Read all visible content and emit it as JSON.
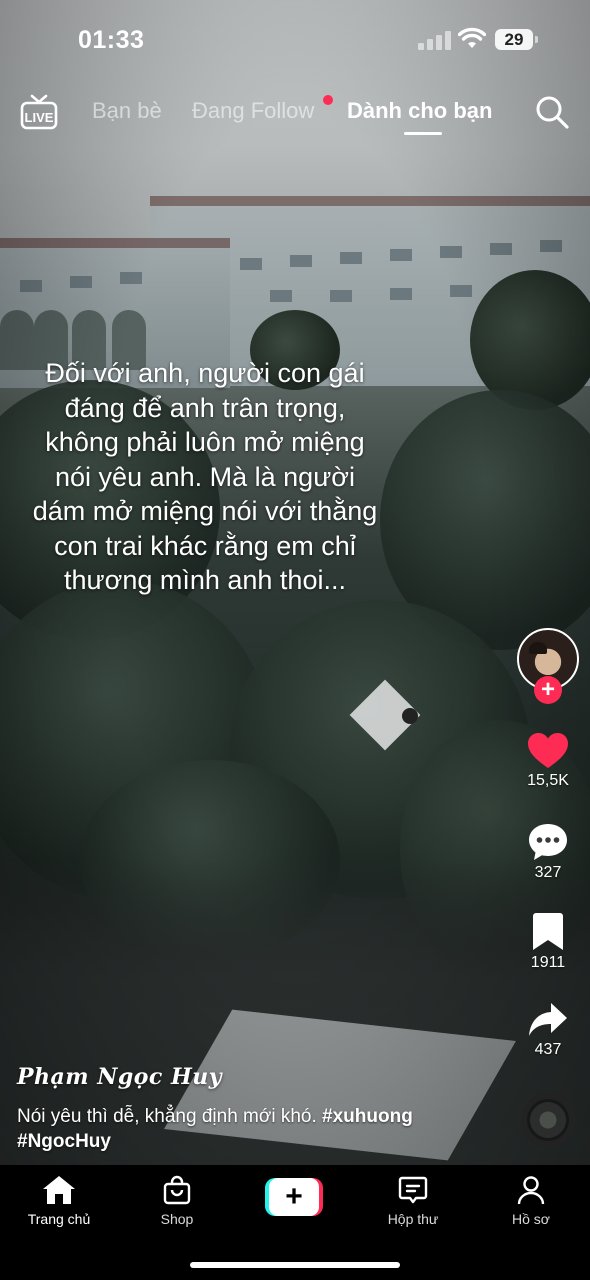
{
  "status_bar": {
    "time": "01:33",
    "battery": "29"
  },
  "top_nav": {
    "live_icon": "live-tv-icon",
    "tabs": [
      {
        "label": "Bạn bè",
        "active": false
      },
      {
        "label": "Đang Follow",
        "active": false,
        "has_dot": true
      },
      {
        "label": "Dành cho bạn",
        "active": true
      }
    ],
    "search_icon": "search-icon"
  },
  "video": {
    "caption_lines": [
      "Đối với anh, người con gái",
      "đáng để anh trân trọng,",
      "không phải luôn mở miệng",
      "nói yêu anh. Mà là người",
      "dám mở miệng nói với thằng",
      "con trai khác rằng em chỉ",
      "thương mình anh thoi..."
    ]
  },
  "actions": {
    "like_count": "15,5K",
    "comment_count": "327",
    "save_count": "1911",
    "share_count": "437",
    "follow_plus": "+"
  },
  "post": {
    "author": "Phạm Ngọc Huy",
    "description_text": "Nói yêu thì dễ, khẳng định mới khó.",
    "hashtags": [
      "#xuhuong",
      "#NgocHuy"
    ]
  },
  "bottom_nav": {
    "items": [
      {
        "label": "Trang chủ",
        "icon": "home-icon",
        "active": true
      },
      {
        "label": "Shop",
        "icon": "shopping-bag-icon",
        "active": false
      },
      {
        "label": "+",
        "icon": "create-icon",
        "active": false
      },
      {
        "label": "Hộp thư",
        "icon": "inbox-icon",
        "active": false
      },
      {
        "label": "Hồ sơ",
        "icon": "profile-icon",
        "active": false
      }
    ]
  },
  "colors": {
    "accent": "#fe2c55",
    "cyan": "#25f4ee",
    "like": "#fe2c55",
    "background": "#000000"
  }
}
